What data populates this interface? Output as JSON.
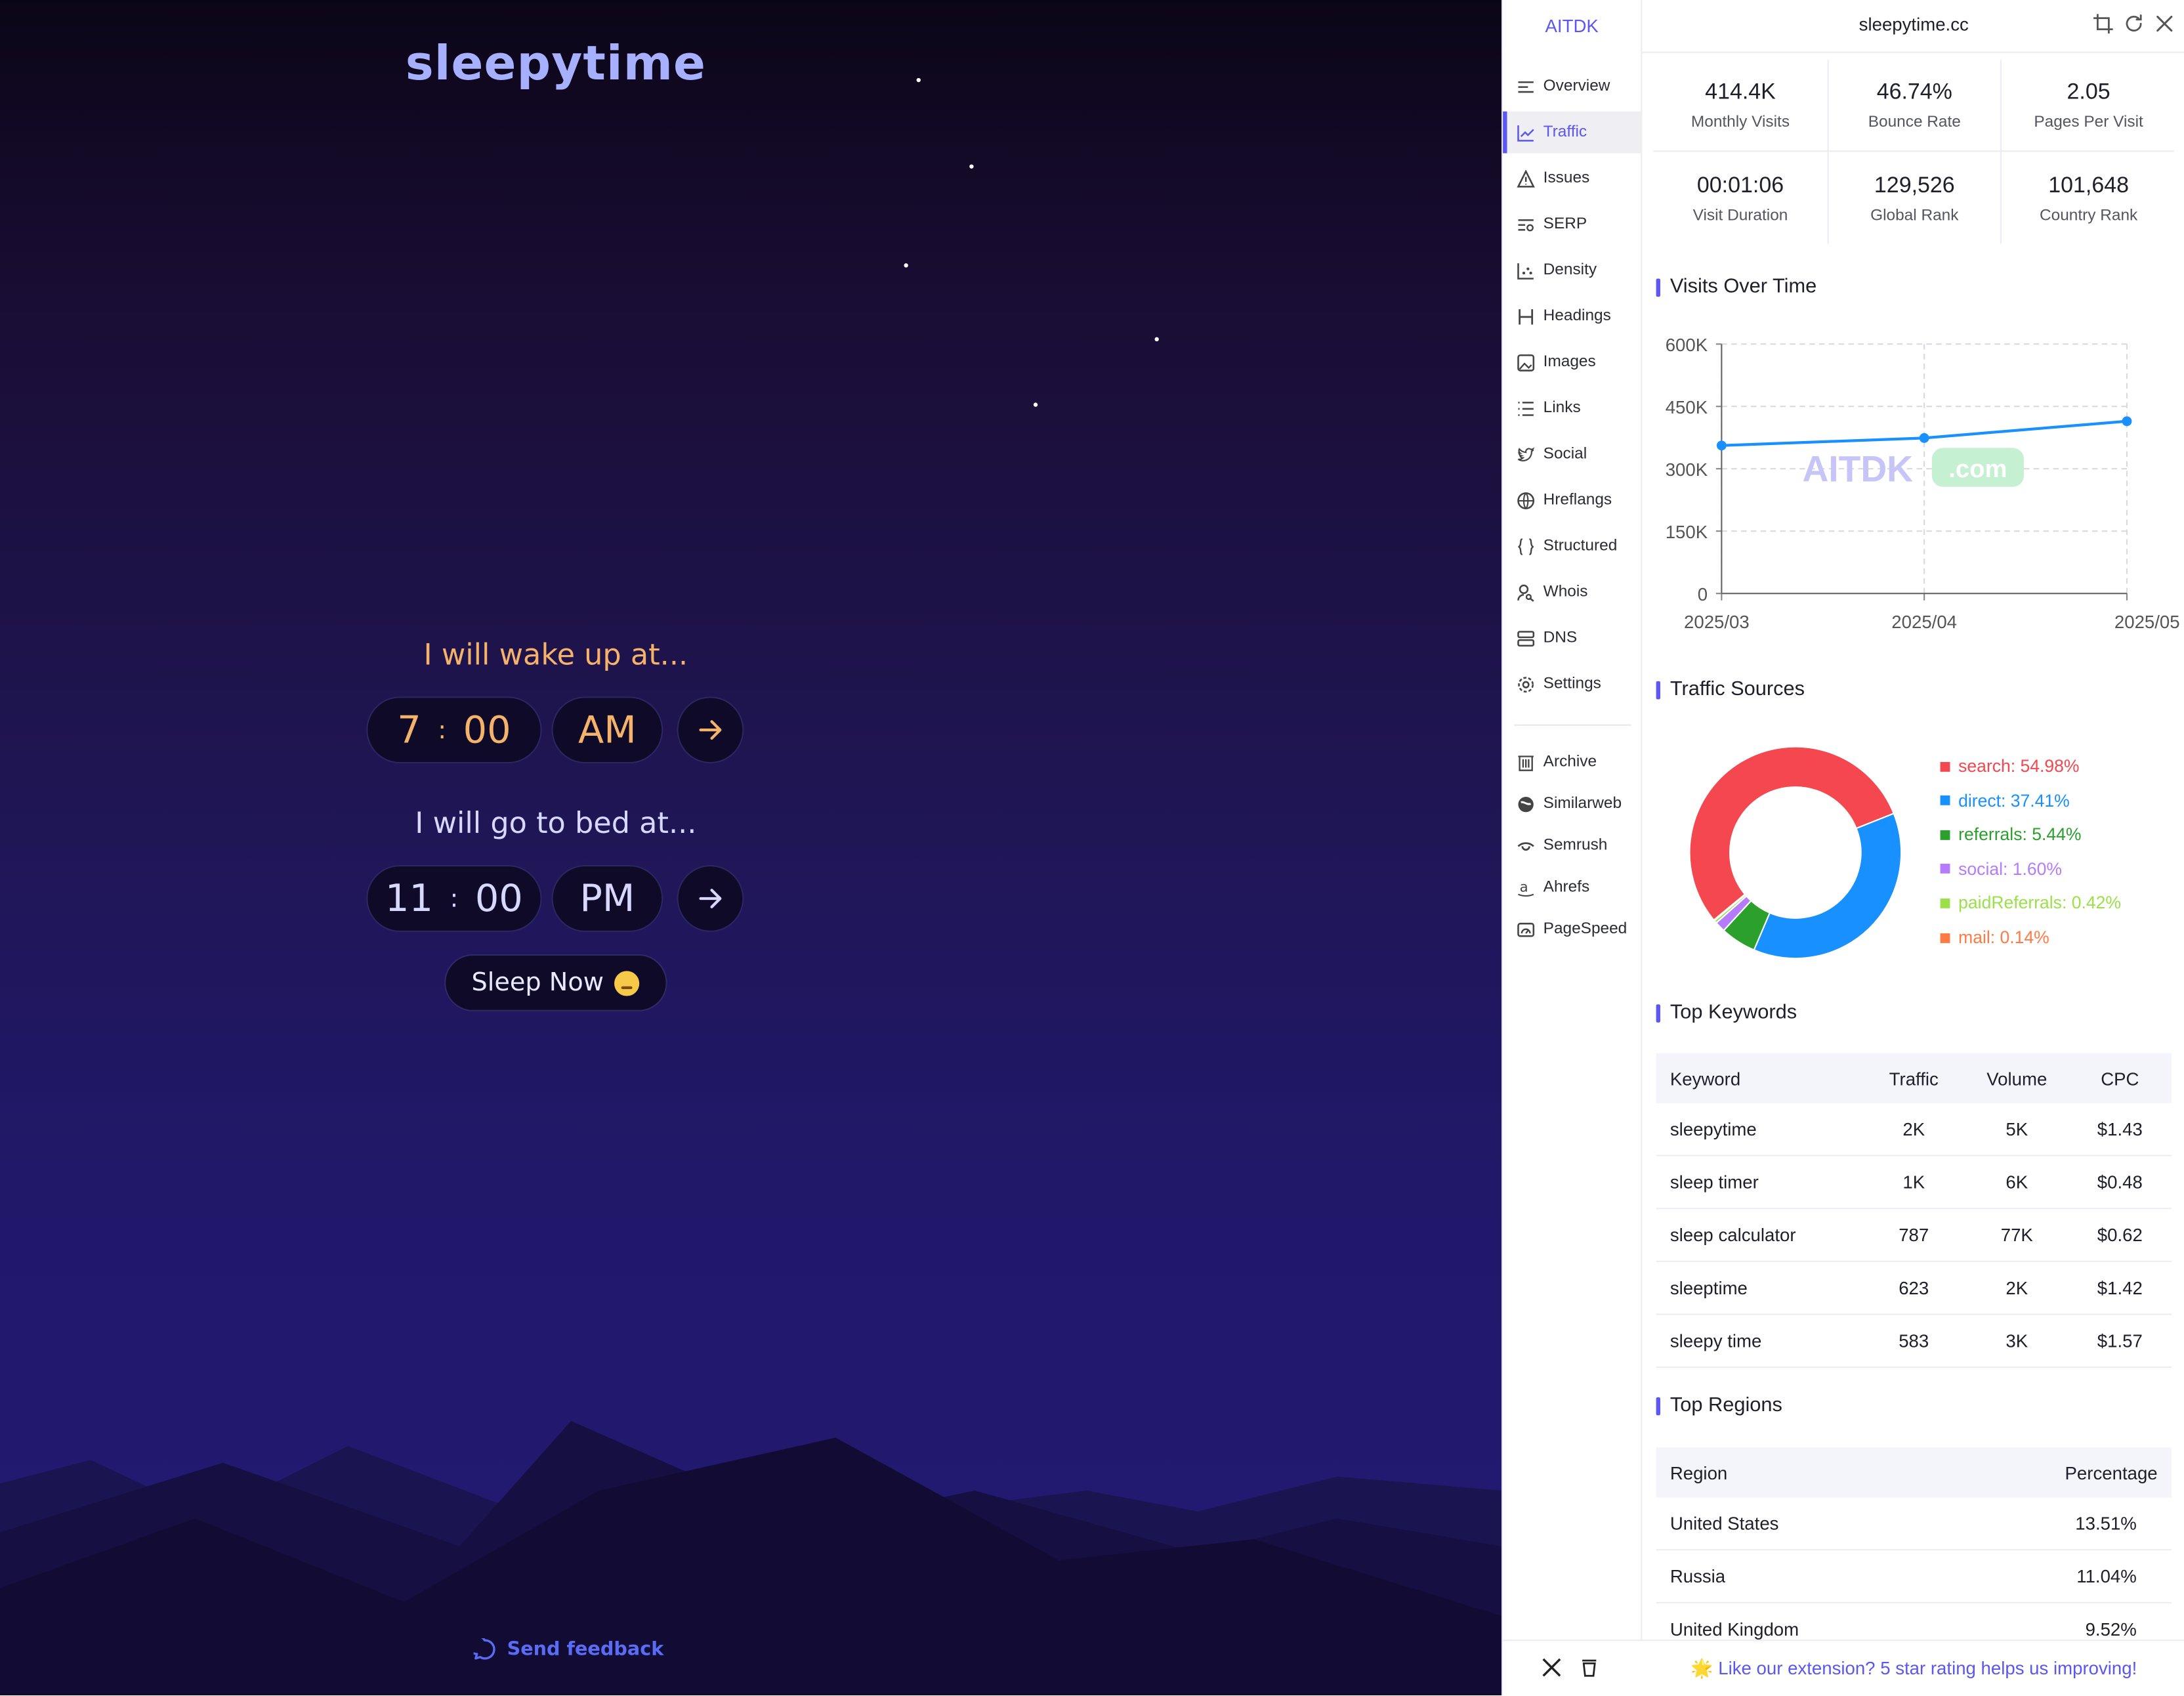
{
  "app": {
    "brand": "sleepytime",
    "wake_prompt": "I will wake up at...",
    "wake_hour": "7",
    "wake_min": "00",
    "wake_ampm": "AM",
    "bed_prompt": "I will go to bed at...",
    "bed_hour": "11",
    "bed_min": "00",
    "bed_ampm": "PM",
    "sleep_now": "Sleep Now",
    "feedback": "Send feedback",
    "colors": {
      "wake": "#f4b26b",
      "bed": "#d8d8ff",
      "brand": "#a6b0ff"
    }
  },
  "panel": {
    "logo": "AITDK",
    "domain": "sleepytime.cc",
    "nav": [
      "Overview",
      "Traffic",
      "Issues",
      "SERP",
      "Density",
      "Headings",
      "Images",
      "Links",
      "Social",
      "Hreflangs",
      "Structured",
      "Whois",
      "DNS",
      "Settings"
    ],
    "nav_active": "Traffic",
    "ext": [
      "Archive",
      "Similarweb",
      "Semrush",
      "Ahrefs",
      "PageSpeed"
    ],
    "stats": [
      {
        "value": "414.4K",
        "label": "Monthly Visits"
      },
      {
        "value": "46.74%",
        "label": "Bounce Rate"
      },
      {
        "value": "2.05",
        "label": "Pages Per Visit"
      },
      {
        "value": "00:01:06",
        "label": "Visit Duration"
      },
      {
        "value": "129,526",
        "label": "Global Rank"
      },
      {
        "value": "101,648",
        "label": "Country Rank"
      }
    ],
    "visits_title": "Visits Over Time",
    "sources_title": "Traffic Sources",
    "keywords_title": "Top Keywords",
    "regions_title": "Top Regions",
    "watermark": "AITDK",
    "watermark_suffix": ".com",
    "keywords": {
      "headers": [
        "Keyword",
        "Traffic",
        "Volume",
        "CPC"
      ],
      "rows": [
        [
          "sleepytime",
          "2K",
          "5K",
          "$1.43"
        ],
        [
          "sleep timer",
          "1K",
          "6K",
          "$0.48"
        ],
        [
          "sleep calculator",
          "787",
          "77K",
          "$0.62"
        ],
        [
          "sleeptime",
          "623",
          "2K",
          "$1.42"
        ],
        [
          "sleepy time",
          "583",
          "3K",
          "$1.57"
        ]
      ]
    },
    "regions": {
      "headers": [
        "Region",
        "Percentage"
      ],
      "rows": [
        [
          "United States",
          "13.51%"
        ],
        [
          "Russia",
          "11.04%"
        ],
        [
          "United Kingdom",
          "9.52%"
        ]
      ]
    },
    "rating": "🌟 Like our extension? 5 star rating helps us improving!"
  },
  "chart_data": [
    {
      "type": "line",
      "title": "Visits Over Time",
      "x": [
        "2025/03",
        "2025/04",
        "2025/05"
      ],
      "y": [
        356000,
        374000,
        414400
      ],
      "yticks": [
        "0",
        "150K",
        "300K",
        "450K",
        "600K"
      ],
      "ylim": [
        0,
        600000
      ],
      "grid": true,
      "color": "#1890ff"
    },
    {
      "type": "pie",
      "title": "Traffic Sources",
      "labels": [
        "search",
        "direct",
        "referrals",
        "social",
        "paidReferrals",
        "mail"
      ],
      "values": [
        54.98,
        37.41,
        5.44,
        1.6,
        0.42,
        0.14
      ],
      "display": [
        "search: 54.98%",
        "direct: 37.41%",
        "referrals: 5.44%",
        "social: 1.60%",
        "paidReferrals: 0.42%",
        "mail: 0.14%"
      ],
      "colors": [
        "#f5474f",
        "#1890ff",
        "#2ca02c",
        "#b57bff",
        "#9be04a",
        "#ff7a45"
      ],
      "legend": "right"
    }
  ]
}
